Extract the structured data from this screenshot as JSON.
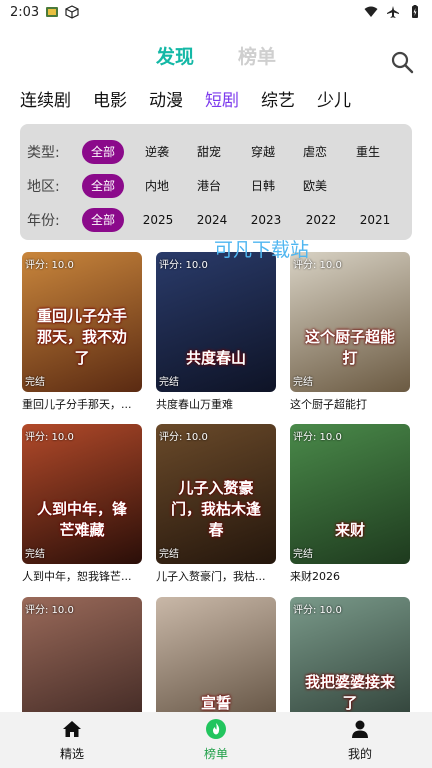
{
  "status_bar": {
    "time": "2:03"
  },
  "top_tabs": {
    "discover": "发现",
    "ranking": "榜单"
  },
  "categories": [
    "连续剧",
    "电影",
    "动漫",
    "短剧",
    "综艺",
    "少儿"
  ],
  "filters": {
    "type": {
      "label": "类型:",
      "options": [
        "全部",
        "逆袭",
        "甜宠",
        "穿越",
        "虐恋",
        "重生"
      ]
    },
    "region": {
      "label": "地区:",
      "options": [
        "全部",
        "内地",
        "港台",
        "日韩",
        "欧美"
      ]
    },
    "year": {
      "label": "年份:",
      "options": [
        "全部",
        "2025",
        "2024",
        "2023",
        "2022",
        "2021"
      ]
    }
  },
  "watermark": "可凡下载站",
  "cards": [
    {
      "score": "评分: 10.0",
      "status": "完结",
      "poster_text": "重回儿子分手那天，我不劝了",
      "title": "重回儿子分手那天，...",
      "color1": "#c9863c",
      "color2": "#5a2a12"
    },
    {
      "score": "评分: 10.0",
      "status": "完结",
      "poster_text": "共度春山",
      "title": "共度春山万重难",
      "color1": "#2a3b6a",
      "color2": "#0e1326"
    },
    {
      "score": "评分: 10.0",
      "status": "完结",
      "poster_text": "这个厨子超能打",
      "title": "这个厨子超能打",
      "color1": "#d8d2c4",
      "color2": "#6b5a42"
    },
    {
      "score": "评分: 10.0",
      "status": "完结",
      "poster_text": "人到中年，锋芒难藏",
      "title": "人到中年，恕我锋芒...",
      "color1": "#b24a2a",
      "color2": "#2a0e08"
    },
    {
      "score": "评分: 10.0",
      "status": "完结",
      "poster_text": "儿子入赘豪门，我枯木逢春",
      "title": "儿子入赘豪门，我枯...",
      "color1": "#6a4a2a",
      "color2": "#24160c"
    },
    {
      "score": "评分: 10.0",
      "status": "完结",
      "poster_text": "来财",
      "title": "来财2026",
      "color1": "#4a8a4a",
      "color2": "#1e3a1e"
    },
    {
      "score": "评分: 10.0",
      "status": "",
      "poster_text": "",
      "title": "",
      "color1": "#9a6a5a",
      "color2": "#3a2420"
    },
    {
      "score": "",
      "status": "",
      "poster_text": "宣誓",
      "title": "",
      "color1": "#c9b8a8",
      "color2": "#5a4a3a"
    },
    {
      "score": "评分: 10.0",
      "status": "",
      "poster_text": "我把婆婆接来了",
      "title": "",
      "color1": "#7a9a8a",
      "color2": "#2a3a32"
    }
  ],
  "bottom_nav": {
    "home": "精选",
    "ranking": "榜单",
    "mine": "我的"
  },
  "colors": {
    "accent": "#14b8a6",
    "chip_active": "#8b0a8b",
    "category_active": "#7c3aed"
  }
}
